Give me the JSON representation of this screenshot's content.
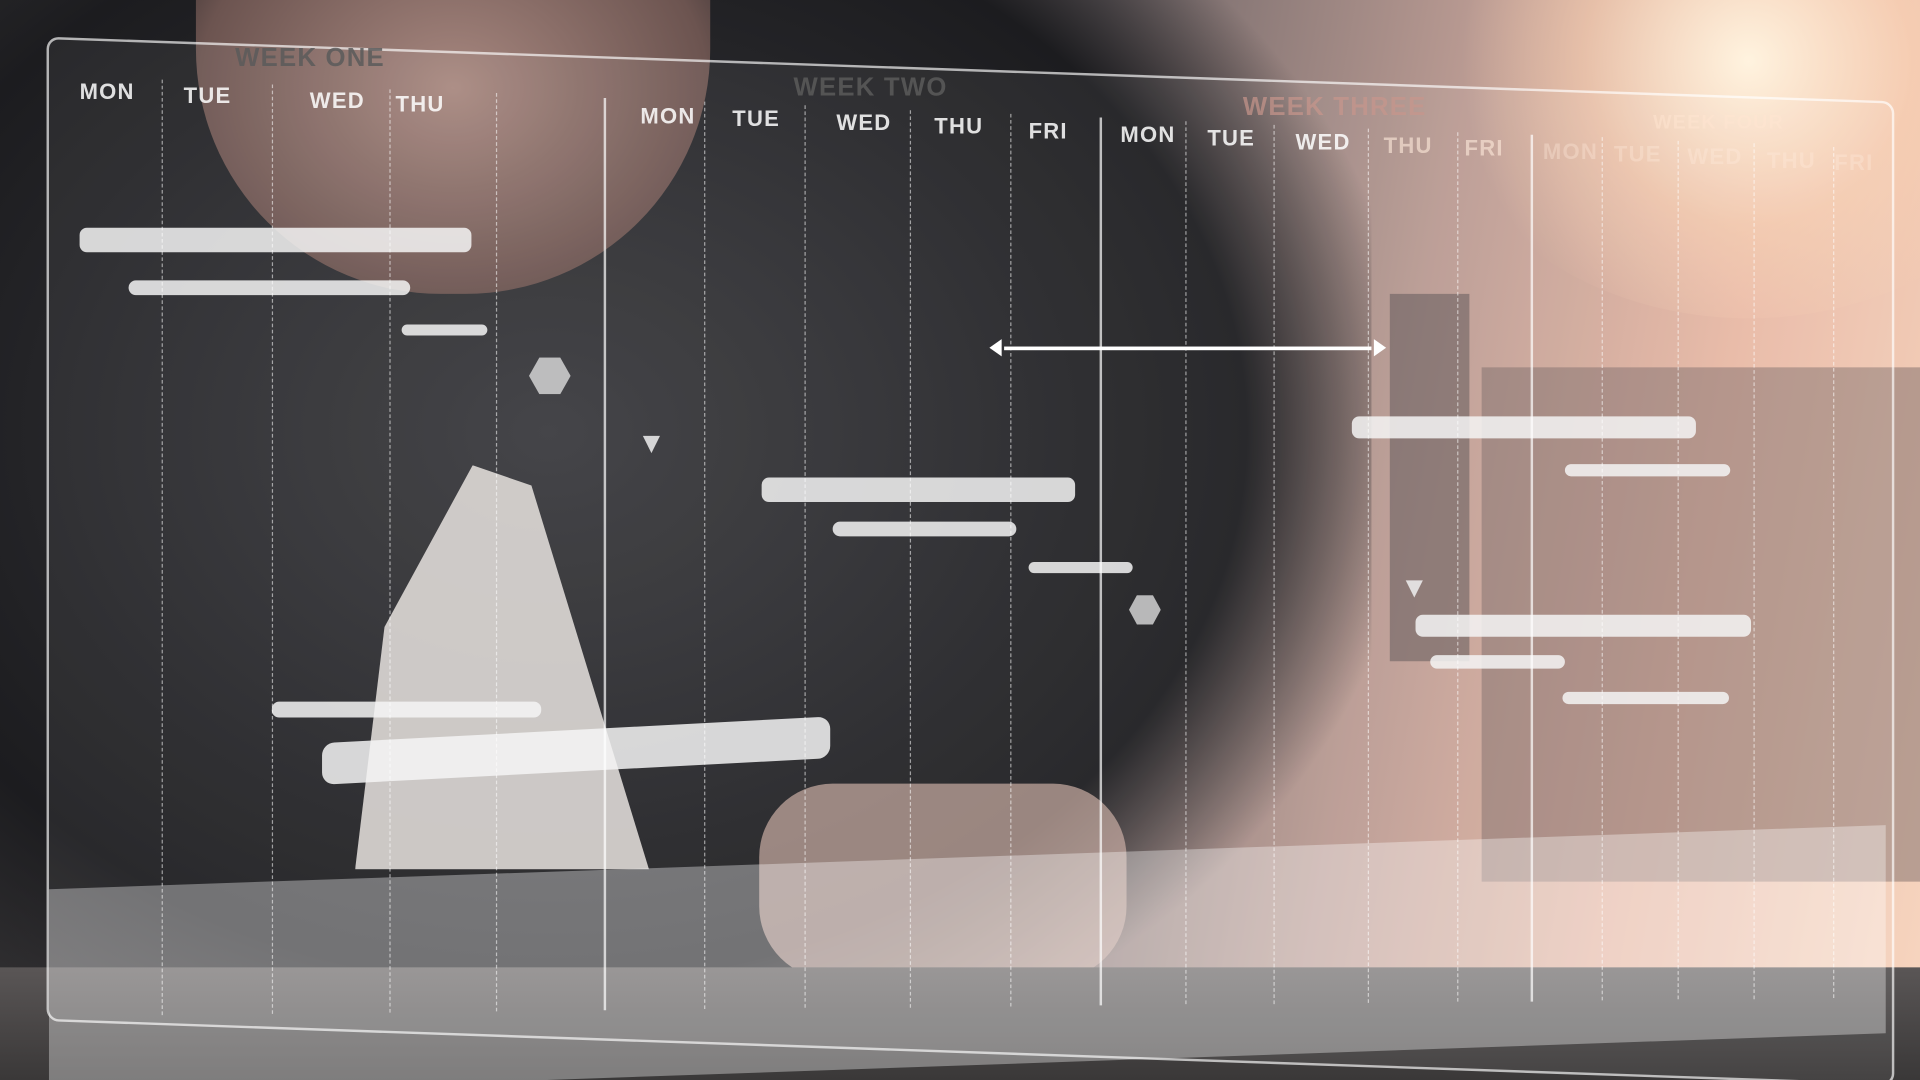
{
  "weeks": [
    {
      "label": "WEEK ONE",
      "days": [
        "MON",
        "TUE",
        "WED",
        "THU"
      ]
    },
    {
      "label": "WEEK TWO",
      "days": [
        "MON",
        "TUE",
        "WED",
        "THU",
        "FRI"
      ]
    },
    {
      "label": "WEEK THREE",
      "days": [
        "MON",
        "TUE",
        "WED",
        "THU",
        "FRI"
      ]
    },
    {
      "label": "WEEK FOUR",
      "days": [
        "MON",
        "TUE",
        "WED",
        "THU",
        "FRI"
      ]
    }
  ],
  "colors": {
    "overlay": "#ffffff",
    "warm_glow": "#f7d6c0",
    "dark": "#1c1c1f"
  }
}
